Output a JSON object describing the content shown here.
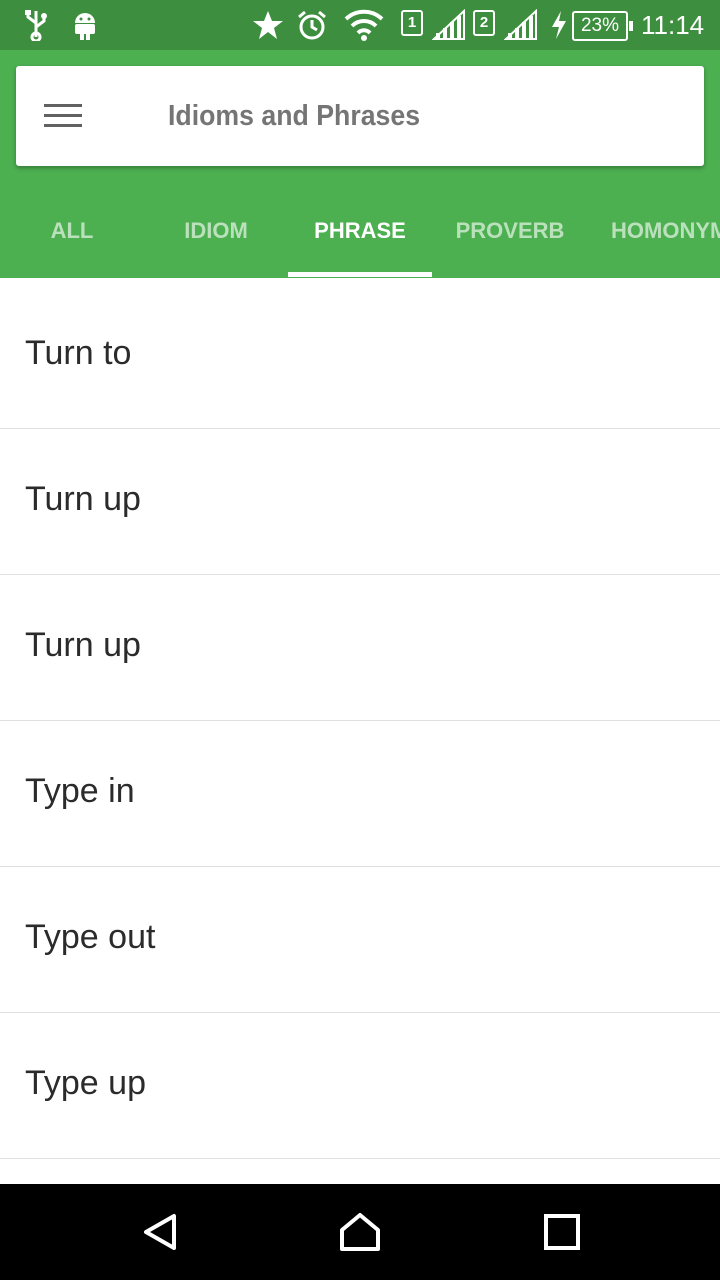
{
  "status_bar": {
    "sim1": "1",
    "sim2": "2",
    "battery": "23%",
    "time": "11:14",
    "icons": [
      "usb-icon",
      "android-icon",
      "star-icon",
      "alarm-icon",
      "wifi-icon",
      "signal-icon",
      "charging-icon",
      "battery-icon"
    ]
  },
  "app_bar": {
    "title": "Idioms and Phrases",
    "menu_icon": "hamburger-menu-icon"
  },
  "tabs": [
    {
      "label": "ALL",
      "active": false
    },
    {
      "label": "IDIOM",
      "active": false
    },
    {
      "label": "PHRASE",
      "active": true
    },
    {
      "label": "PROVERB",
      "active": false
    },
    {
      "label": "HOMONYMS",
      "active": false
    }
  ],
  "list": {
    "items": [
      "Turn to",
      "Turn up",
      "Turn up",
      "Type in",
      "Type out",
      "Type up"
    ]
  },
  "nav_bar": {
    "buttons": [
      "back-icon",
      "home-icon",
      "recents-icon"
    ]
  },
  "colors": {
    "status_bar": "#3d8f3f",
    "primary": "#4caf50"
  }
}
